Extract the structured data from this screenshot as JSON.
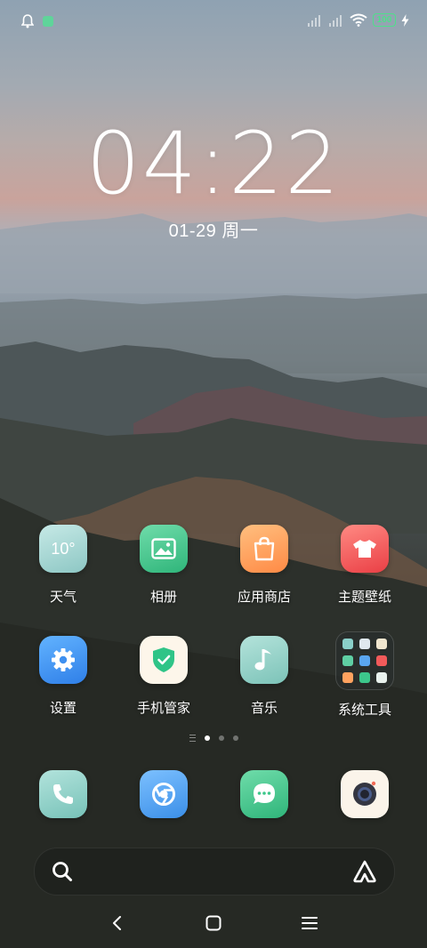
{
  "status_bar": {
    "battery_level": "100",
    "icons": [
      "notification-bell-icon",
      "app-notification-icon",
      "signal-icon",
      "signal-icon",
      "wifi-icon",
      "battery-icon",
      "charging-icon"
    ]
  },
  "clock": {
    "time": "04:22",
    "date": "01-29 周一"
  },
  "apps": [
    {
      "label": "天气",
      "icon": "weather-icon",
      "temp": "10°",
      "color": "#9fd3d0"
    },
    {
      "label": "相册",
      "icon": "gallery-icon",
      "color": "#45c98f"
    },
    {
      "label": "应用商店",
      "icon": "app-store-icon",
      "color": "#ff9c5a"
    },
    {
      "label": "主题壁纸",
      "icon": "theme-icon",
      "color": "#f25a5a"
    },
    {
      "label": "设置",
      "icon": "gear-icon",
      "color": "#3d8ff0"
    },
    {
      "label": "手机管家",
      "icon": "phone-manager-icon",
      "color": "#fdf6ea"
    },
    {
      "label": "音乐",
      "icon": "music-icon",
      "color": "#8ecfc5"
    },
    {
      "label": "系统工具",
      "icon": "folder-icon"
    }
  ],
  "dock": [
    {
      "name": "phone",
      "icon": "phone-icon",
      "color": "#8fd0c7"
    },
    {
      "name": "browser",
      "icon": "browser-icon",
      "color": "#4fa3f0"
    },
    {
      "name": "messages",
      "icon": "messages-icon",
      "color": "#3ec78b"
    },
    {
      "name": "camera",
      "icon": "camera-icon",
      "color": "#fbf4ea"
    }
  ],
  "pager": {
    "pages": 3,
    "active_page": 1
  },
  "search_bar": {
    "icons": [
      "search-icon",
      "assistant-icon"
    ]
  },
  "nav_bar": {
    "icons": [
      "back-icon",
      "home-icon",
      "menu-icon"
    ]
  }
}
